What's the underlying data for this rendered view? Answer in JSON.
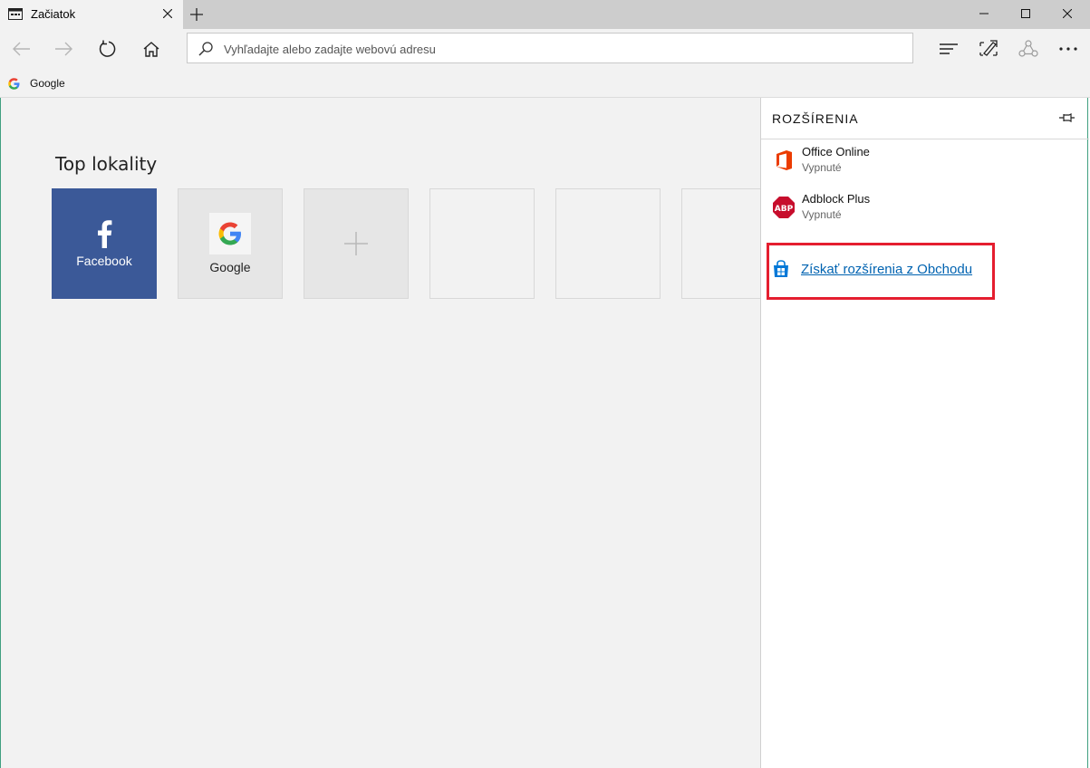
{
  "tab": {
    "title": "Začiatok",
    "favicon": "page-icon"
  },
  "window_controls": [
    "minimize-icon",
    "maximize-icon",
    "close-icon"
  ],
  "nav": {
    "address_placeholder": "Vyhľadajte alebo zadajte webovú adresu"
  },
  "favorites_bar": {
    "items": [
      {
        "label": "Google",
        "icon": "google-g-icon"
      }
    ]
  },
  "top_sites": {
    "title": "Top lokality",
    "tiles": [
      {
        "label": "Facebook",
        "icon": "facebook-f-icon",
        "color": "#3b5998"
      },
      {
        "label": "Google",
        "icon": "google-g-icon"
      },
      {
        "label": "",
        "icon": "plus-icon"
      }
    ]
  },
  "extensions_pane": {
    "title": "ROZŠÍRENIA",
    "items": [
      {
        "name": "Office Online",
        "status": "Vypnuté",
        "icon": "office-icon",
        "color": "#eb3c00"
      },
      {
        "name": "Adblock Plus",
        "status": "Vypnuté",
        "icon": "abp-icon",
        "color": "#c70d2c"
      }
    ],
    "store_link": "Získať rozšírenia z Obchodu",
    "highlight_color": "#e51e2f",
    "link_color": "#0063b1"
  }
}
